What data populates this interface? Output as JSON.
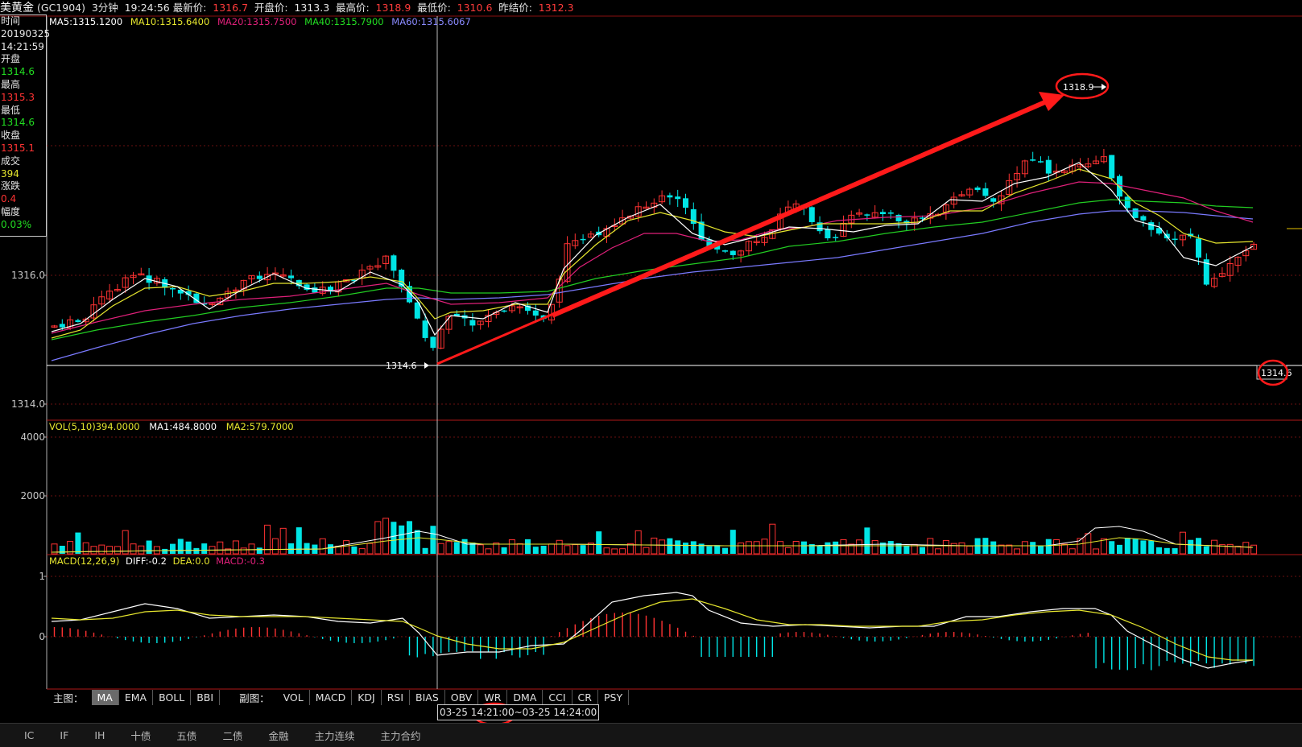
{
  "top_bar": {
    "title": "美黄金",
    "symbol": "(GC1904)",
    "period": "3分钟",
    "time": "19:24:56",
    "latest_label": "最新价:",
    "latest_value": "1316.7",
    "open_label": "开盘价:",
    "open_value": "1313.3",
    "high_label": "最高价:",
    "high_value": "1318.9",
    "low_label": "最低价:",
    "low_value": "1310.6",
    "prev_close_label": "昨结价:",
    "prev_close_value": "1312.3"
  },
  "info_panel": {
    "time_label": "时间",
    "date": "20190325",
    "time": "14:21:59",
    "open_label": "开盘",
    "open": "1314.6",
    "high_label": "最高",
    "high": "1315.3",
    "low_label": "最低",
    "low": "1314.6",
    "close_label": "收盘",
    "close": "1315.1",
    "volume_label": "成交",
    "volume": "394",
    "change_label": "涨跌",
    "change": "0.4",
    "amplitude_label": "幅度",
    "amplitude": "0.03%"
  },
  "ma_legend": {
    "ma5": "MA5:1315.1200",
    "ma10": "MA10:1315.6400",
    "ma20": "MA20:1315.7500",
    "ma40": "MA40:1315.7900",
    "ma60": "MA60:1315.6067"
  },
  "price_axis": {
    "label_1316": "1316.0",
    "label_1314": "1314.0"
  },
  "annotations": {
    "high_marker": "1318.9",
    "low_marker": "1314.6",
    "right_price": "1314.6"
  },
  "vol_legend": {
    "vol": "VOL(5,10)394.0000",
    "ma1": "MA1:484.8000",
    "ma2": "MA2:579.7000"
  },
  "vol_axis": {
    "label_4000": "4000",
    "label_2000": "2000"
  },
  "macd_legend": {
    "macd": "MACD(12,26,9)",
    "diff": "DIFF:-0.2",
    "dea": "DEA:0.0",
    "macd_val": "MACD:-0.3"
  },
  "macd_axis": {
    "label_1": "1",
    "label_0": "0"
  },
  "main_tabs": {
    "label": "主图：",
    "items": [
      "MA",
      "EMA",
      "BOLL",
      "BBI"
    ]
  },
  "sub_tabs": {
    "label": "副图：",
    "items": [
      "VOL",
      "MACD",
      "KDJ",
      "RSI",
      "BIAS",
      "OBV",
      "WR",
      "DMA",
      "CCI",
      "CR",
      "PSY"
    ]
  },
  "time_range": {
    "start_date": "03-25",
    "start_time": "14:21:00",
    "end": "~03-25 14:24:00"
  },
  "bottom_tabs": [
    "IC",
    "IF",
    "IH",
    "十债",
    "五债",
    "二债",
    "金融",
    "主力连续",
    "主力合约"
  ],
  "colors": {
    "up": "#ff3232",
    "down": "#00e5e5",
    "ma5": "#ffffff",
    "ma10": "#e6e62e",
    "ma20": "#e0207a",
    "ma40": "#22cc22",
    "ma60": "#7a7aff",
    "annotation": "#ff2020"
  }
}
